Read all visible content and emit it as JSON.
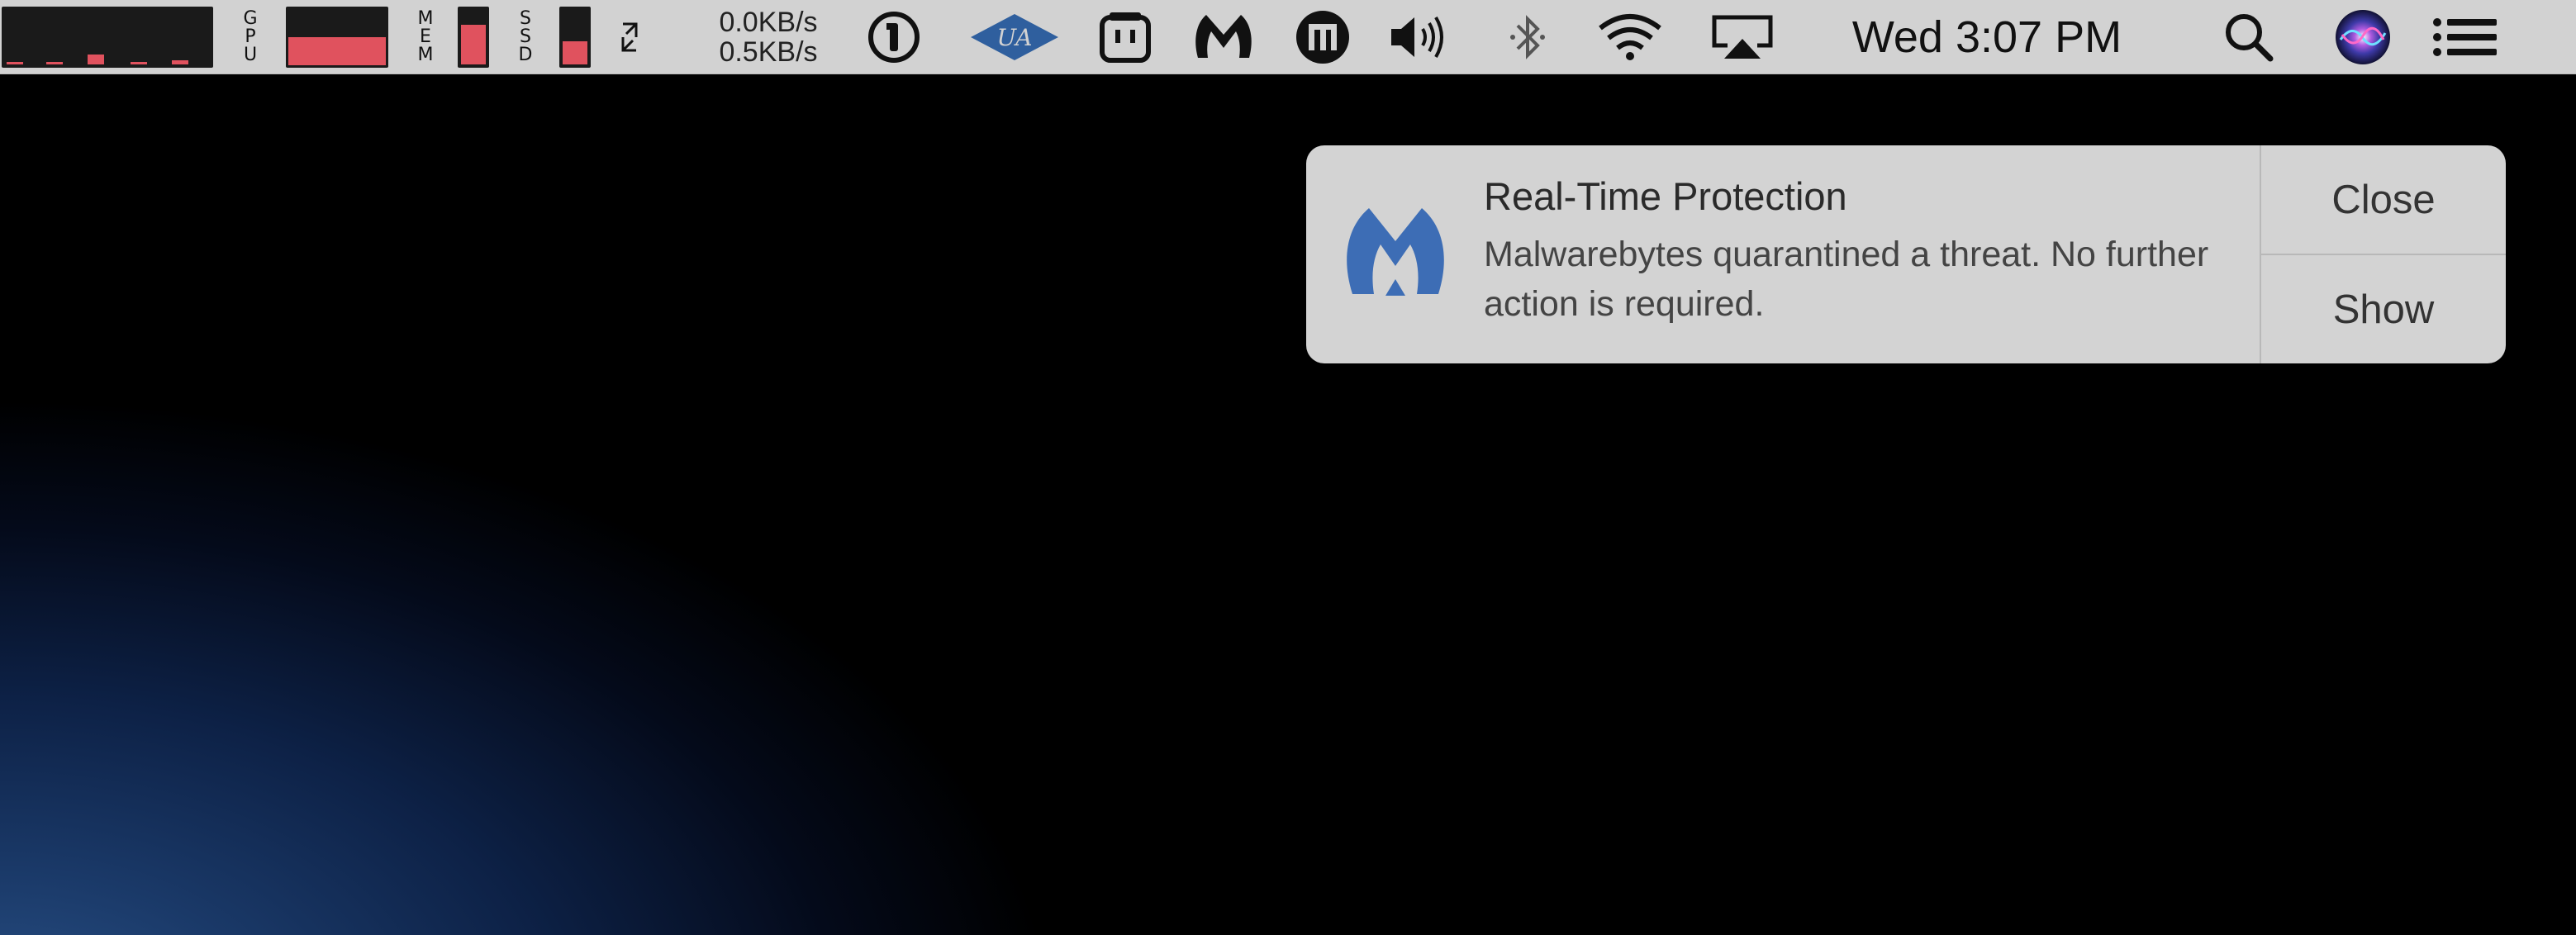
{
  "menubar": {
    "cpu": {
      "icon": "cpu-history-graph",
      "levels": [
        0.05,
        0.04,
        0.18,
        0.04,
        0.08
      ],
      "color": "#e0525e"
    },
    "gpu": {
      "label": [
        "G",
        "P",
        "U"
      ],
      "level": 0.5
    },
    "mem": {
      "label": [
        "M",
        "E",
        "M"
      ],
      "level": 0.72
    },
    "ssd": {
      "label": [
        "S",
        "S",
        "D"
      ],
      "level": 0.42
    },
    "network": {
      "arrows_icon": "network-arrows-icon",
      "down": "0.0KB/s",
      "up": "0.5KB/s"
    },
    "status_icons": [
      "1password-icon",
      "universal-audio-icon",
      "droplr-icon",
      "malwarebytes-icon",
      "mi-icon",
      "volume-icon",
      "bluetooth-icon",
      "wifi-icon",
      "airplay-icon"
    ],
    "clock": "Wed 3:07 PM",
    "right_icons": [
      "spotlight-search-icon",
      "siri-icon",
      "notification-center-icon"
    ]
  },
  "notification": {
    "app_icon": "malwarebytes-icon",
    "accent": "#3d6db5",
    "title": "Real-Time Protection",
    "body": "Malwarebytes quarantined a threat. No further action is required.",
    "close_label": "Close",
    "show_label": "Show"
  }
}
